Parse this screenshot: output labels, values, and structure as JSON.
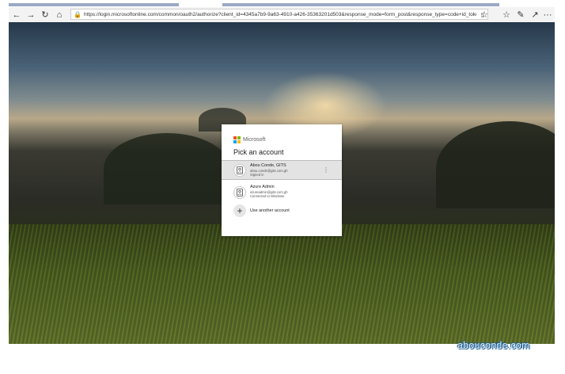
{
  "browser": {
    "url": "https://login.microsoftonline.com/common/oauth2/authorize?client_id=4345a7b9-9a63-4910-a426-35363201d503&response_mode=form_post&response_type=code+id_token&sc",
    "icons": {
      "back": "←",
      "forward": "→",
      "refresh": "↻",
      "home": "⌂",
      "lock": "🔒",
      "reader": "▯",
      "favorite": "☆",
      "favorites_bar": "☆",
      "pen": "✎",
      "share": "↗",
      "more": "···"
    }
  },
  "signin": {
    "brand": "Microsoft",
    "title": "Pick an account",
    "logo_colors": [
      "#f25022",
      "#7fba00",
      "#00a4ef",
      "#ffb900"
    ],
    "accounts": [
      {
        "name": "Abou Conde, GITS",
        "email": "abou.conde@gits.com.gh",
        "status": "Signed in",
        "more": "⋮"
      },
      {
        "name": "Azure Admin",
        "email": "azureadmin@gits.com.gh",
        "status": "Connected to Windows",
        "more": ""
      }
    ],
    "add_account": {
      "icon": "+",
      "label": "Use another account"
    }
  },
  "watermark": "abouconde.com"
}
